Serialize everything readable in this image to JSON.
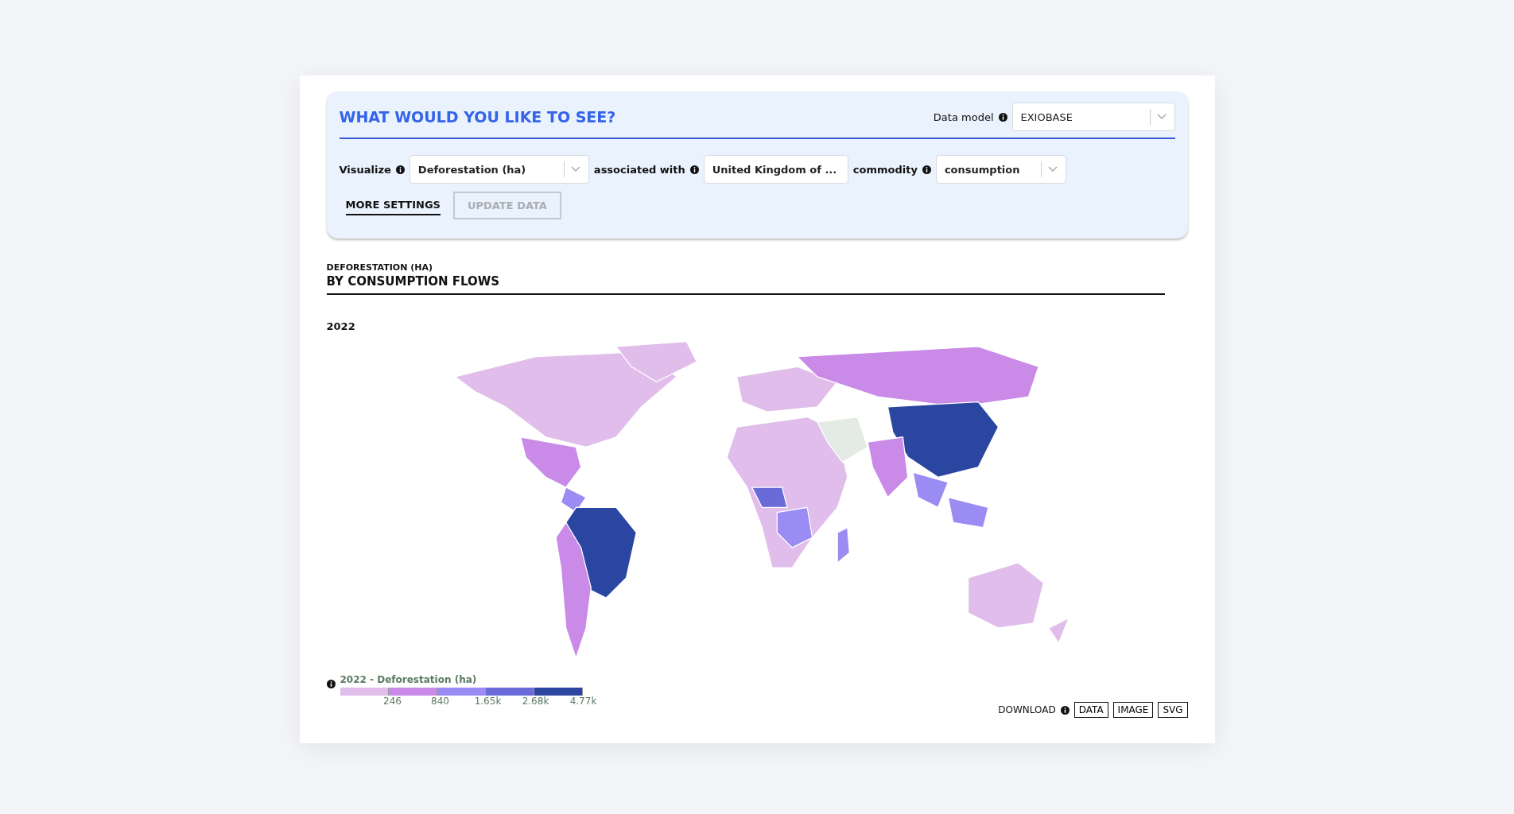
{
  "panel": {
    "title": "WHAT WOULD YOU LIKE TO SEE?",
    "data_model": {
      "label": "Data model",
      "value": "EXIOBASE"
    },
    "filters": [
      {
        "label": "Visualize",
        "value": "Deforestation (ha)"
      },
      {
        "label": "associated with",
        "value": "United Kingdom of ..."
      },
      {
        "label": "commodity",
        "value": "consumption"
      }
    ],
    "tabs": [
      {
        "label": "MORE SETTINGS",
        "selected": true
      }
    ],
    "update_button": {
      "label": "UPDATE DATA",
      "disabled": true
    }
  },
  "chart": {
    "subtitle": "DEFORESTATION (HA)",
    "title": "BY CONSUMPTION FLOWS",
    "year": "2022"
  },
  "legend": {
    "title": "2022 - Deforestation (ha)",
    "bins": [
      {
        "color": "#e0bdeb"
      },
      {
        "color": "#c98ae8",
        "label": "246"
      },
      {
        "color": "#9b8cf3",
        "label": "840"
      },
      {
        "color": "#6a6ad8",
        "label": "1.65k"
      },
      {
        "color": "#2b46a0",
        "label": "2.68k"
      }
    ],
    "max_label": "4.77k"
  },
  "download": {
    "label": "DOWNLOAD",
    "buttons": [
      "DATA",
      "IMAGE",
      "SVG"
    ]
  }
}
